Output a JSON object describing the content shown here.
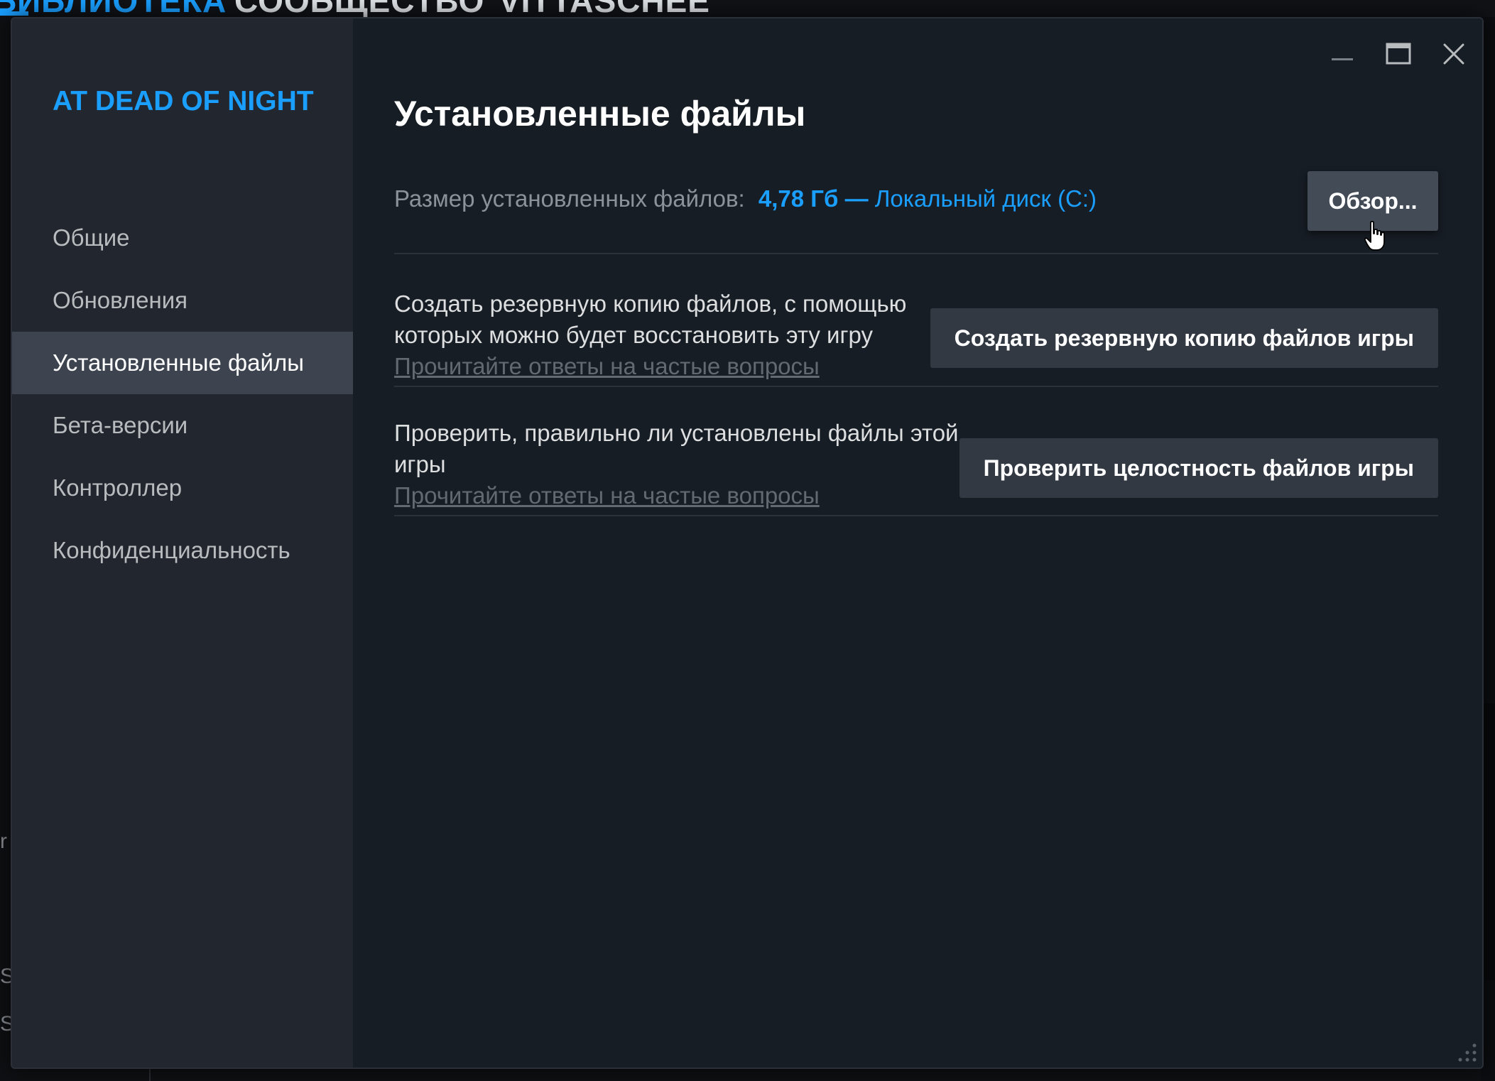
{
  "background": {
    "nav_tabs": [
      {
        "label": "БИБЛИОТЕКА",
        "active": true
      },
      {
        "label": "СООБЩЕСТВО",
        "active": false
      },
      {
        "label": "VITTASCHEE",
        "active": false
      }
    ],
    "left_letters": [
      "r",
      "S",
      "S"
    ]
  },
  "dialog": {
    "game_title": "AT DEAD OF NIGHT",
    "nav": [
      {
        "label": "Общие",
        "active": false
      },
      {
        "label": "Обновления",
        "active": false
      },
      {
        "label": "Установленные файлы",
        "active": true
      },
      {
        "label": "Бета-версии",
        "active": false
      },
      {
        "label": "Контроллер",
        "active": false
      },
      {
        "label": "Конфиденциальность",
        "active": false
      }
    ],
    "window_controls": {
      "minimize_icon": "minimize-icon",
      "maximize_icon": "maximize-icon",
      "close_icon": "close-icon"
    },
    "content": {
      "title": "Установленные файлы",
      "size_label": "Размер установленных файлов:",
      "size_value": "4,78 Гб",
      "size_separator": "—",
      "disk_label": "Локальный диск (C:)",
      "browse_button": "Обзор...",
      "backup": {
        "description": "Создать резервную копию файлов, с помощью которых можно будет восстановить эту игру",
        "faq_link": "Прочитайте ответы на частые вопросы",
        "button": "Создать резервную копию файлов игры"
      },
      "verify": {
        "description": "Проверить, правильно ли установлены файлы этой игры",
        "faq_link": "Прочитайте ответы на частые вопросы",
        "button": "Проверить целостность файлов игры"
      }
    }
  },
  "colors": {
    "accent": "#1a9fff",
    "dialog_bg": "#171d25",
    "sidebar_bg": "#22262e",
    "active_item_bg": "#3d4450",
    "button_bg": "#323943"
  }
}
